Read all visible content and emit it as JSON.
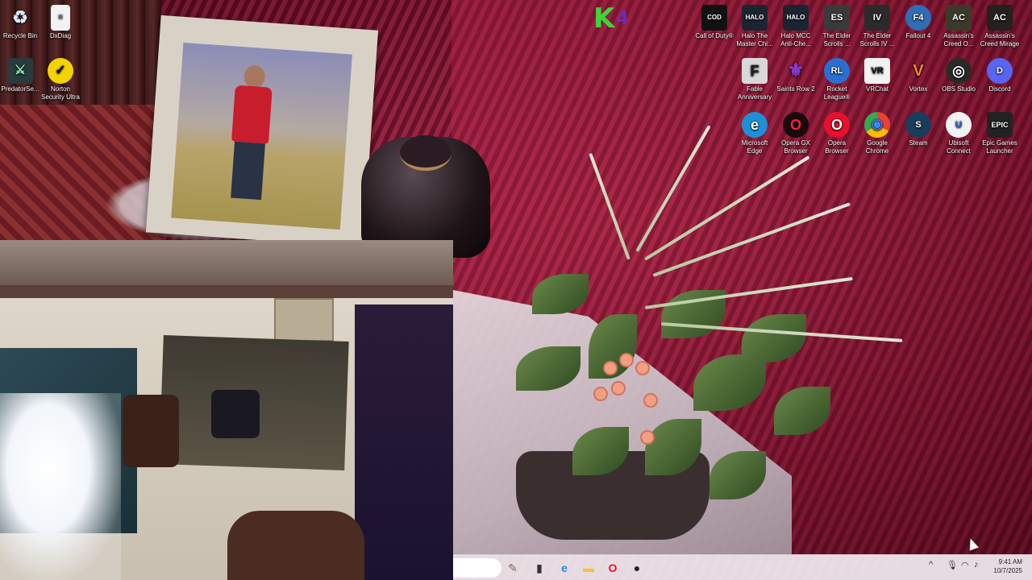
{
  "desktop": {
    "left_icons": [
      {
        "label": "Recycle Bin",
        "icon": "recycle-bin-icon",
        "color": "#5b8fc9"
      },
      {
        "label": "DxDiag",
        "icon": "document-icon",
        "color": "#f2f2f2"
      },
      {
        "label": "PredatorSe...",
        "icon": "predator-sense-icon",
        "color": "#2b3a3c"
      },
      {
        "label": "Norton Security Ultra",
        "icon": "norton-icon",
        "color": "#f5d300"
      }
    ],
    "right_icons_row1": [
      {
        "label": "Call of Duty®",
        "icon": "call-of-duty-icon",
        "glyph": "COD",
        "color": "#111111"
      },
      {
        "label": "Halo The Master Chi...",
        "icon": "halo-mcc-icon",
        "glyph": "HALO",
        "color": "#1b2530"
      },
      {
        "label": "Halo MCC Anti-Che...",
        "icon": "halo-anticheat-icon",
        "glyph": "HALO",
        "color": "#1b2530"
      },
      {
        "label": "The Elder Scrolls ...",
        "icon": "elder-scrolls-icon",
        "glyph": "ES",
        "color": "#3a3a3a"
      },
      {
        "label": "The Elder Scrolls IV ...",
        "icon": "oblivion-icon",
        "glyph": "IV",
        "color": "#2b2b2b"
      },
      {
        "label": "Fallout 4",
        "icon": "fallout-4-icon",
        "glyph": "F4",
        "color": "#2f6db5"
      },
      {
        "label": "Assassin's Creed O...",
        "icon": "assassins-creed-odyssey-icon",
        "glyph": "AC",
        "color": "#3b3a2a"
      },
      {
        "label": "Assassin's Creed Mirage",
        "icon": "assassins-creed-mirage-icon",
        "glyph": "AC",
        "color": "#24211f"
      }
    ],
    "right_icons_row2": [
      {
        "label": "Fable Anniversary",
        "icon": "fable-icon",
        "glyph": "F",
        "color": "#d8d8d8"
      },
      {
        "label": "Saints Row 2",
        "icon": "saints-row-icon",
        "glyph": "⚜",
        "color": "#6a2fb0"
      },
      {
        "label": "Rocket League®",
        "icon": "rocket-league-icon",
        "glyph": "RL",
        "color": "#2a6fd0"
      },
      {
        "label": "VRChat",
        "icon": "vrchat-icon",
        "glyph": "VR",
        "color": "#1d1d1d"
      },
      {
        "label": "Vortex",
        "icon": "vortex-icon",
        "glyph": "V",
        "color": "#e88a2a"
      },
      {
        "label": "OBS Studio",
        "icon": "obs-icon",
        "glyph": "◎",
        "color": "#2a2a2a"
      },
      {
        "label": "Discord",
        "icon": "discord-icon",
        "glyph": "D",
        "color": "#5865f2"
      }
    ],
    "right_icons_row3": [
      {
        "label": "Microsoft Edge",
        "icon": "edge-icon",
        "glyph": "e",
        "color": "#1f8fd8"
      },
      {
        "label": "Opera GX Browser",
        "icon": "opera-gx-icon",
        "glyph": "O",
        "color": "#d11030"
      },
      {
        "label": "Opera Browser",
        "icon": "opera-icon",
        "glyph": "O",
        "color": "#e8102c"
      },
      {
        "label": "Google Chrome",
        "icon": "chrome-icon",
        "glyph": "◉",
        "color": "#35a853"
      },
      {
        "label": "Steam",
        "icon": "steam-icon",
        "glyph": "S",
        "color": "#1b3d5c"
      },
      {
        "label": "Ubisoft Connect",
        "icon": "ubisoft-icon",
        "glyph": "U",
        "color": "#2c5ccf"
      },
      {
        "label": "Epic Games Launcher",
        "icon": "epic-games-icon",
        "glyph": "EPIC",
        "color": "#222222"
      }
    ],
    "widget": {
      "k": "K",
      "k4": "4"
    }
  },
  "taskbar": {
    "apps": [
      {
        "name": "paint-icon",
        "glyph": "✎",
        "color": "#7a6a5a"
      },
      {
        "name": "task-view-icon",
        "glyph": "▮",
        "color": "#333333"
      },
      {
        "name": "edge-taskbar-icon",
        "glyph": "e",
        "color": "#1f8fd8"
      },
      {
        "name": "file-explorer-icon",
        "glyph": "▬",
        "color": "#f4c430"
      },
      {
        "name": "opera-taskbar-icon",
        "glyph": "O",
        "color": "#e8102c"
      },
      {
        "name": "obs-taskbar-icon",
        "glyph": "●",
        "color": "#222222"
      }
    ],
    "tray": {
      "chevron": "^",
      "time": "9:41 AM",
      "date": "10/7/2025"
    }
  }
}
